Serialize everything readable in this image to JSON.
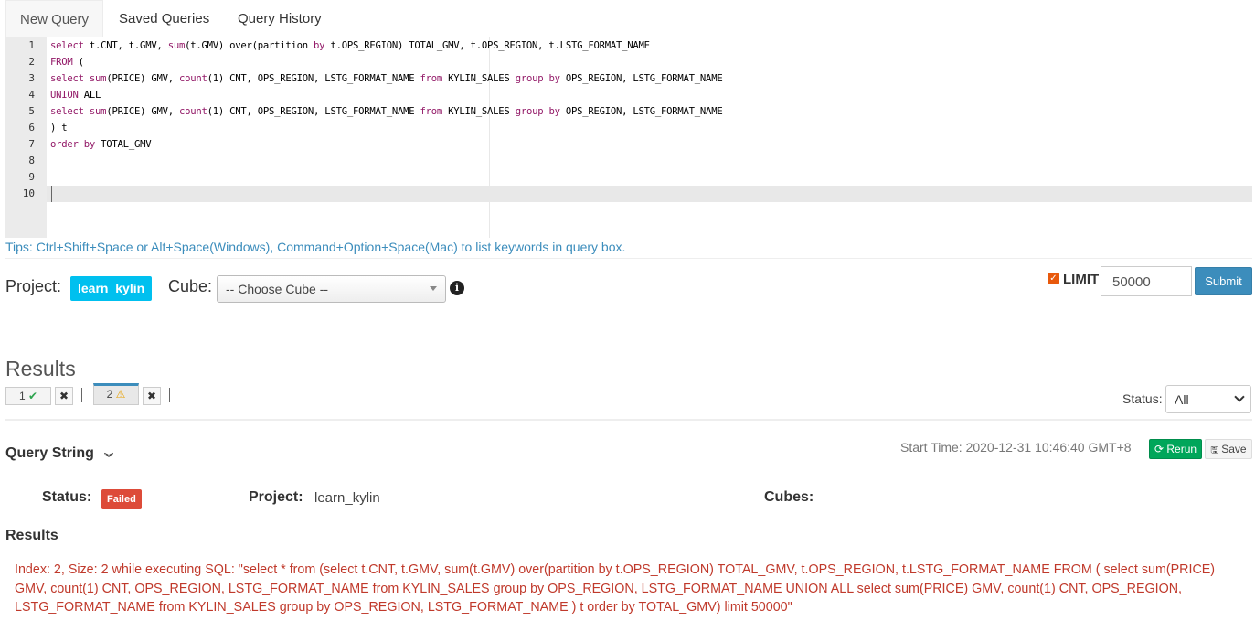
{
  "tabs": [
    {
      "label": "New Query"
    },
    {
      "label": "Saved Queries"
    },
    {
      "label": "Query History"
    }
  ],
  "editor": {
    "line_numbers": [
      "1",
      "2",
      "3",
      "4",
      "5",
      "6",
      "7",
      "8",
      "9",
      "10"
    ],
    "lines": [
      [
        {
          "t": "select",
          "k": true
        },
        {
          "t": " t.CNT, t.GMV, "
        },
        {
          "t": "sum",
          "k": true
        },
        {
          "t": "(t.GMV) over(partition "
        },
        {
          "t": "by",
          "k": true
        },
        {
          "t": " t.OPS_REGION) TOTAL_GMV, t.OPS_REGION, t.LSTG_FORMAT_NAME"
        }
      ],
      [
        {
          "t": "FROM",
          "k": true
        },
        {
          "t": " ("
        }
      ],
      [
        {
          "t": "select",
          "k": true
        },
        {
          "t": " "
        },
        {
          "t": "sum",
          "k": true
        },
        {
          "t": "(PRICE) GMV, "
        },
        {
          "t": "count",
          "k": true
        },
        {
          "t": "(1) CNT, OPS_REGION, LSTG_FORMAT_NAME "
        },
        {
          "t": "from",
          "k": true
        },
        {
          "t": " KYLIN_SALES "
        },
        {
          "t": "group",
          "k": true
        },
        {
          "t": " "
        },
        {
          "t": "by",
          "k": true
        },
        {
          "t": " OPS_REGION, LSTG_FORMAT_NAME"
        }
      ],
      [
        {
          "t": "UNION",
          "k": true
        },
        {
          "t": " ALL"
        }
      ],
      [
        {
          "t": "select",
          "k": true
        },
        {
          "t": " "
        },
        {
          "t": "sum",
          "k": true
        },
        {
          "t": "(PRICE) GMV, "
        },
        {
          "t": "count",
          "k": true
        },
        {
          "t": "(1) CNT, OPS_REGION, LSTG_FORMAT_NAME "
        },
        {
          "t": "from",
          "k": true
        },
        {
          "t": " KYLIN_SALES "
        },
        {
          "t": "group",
          "k": true
        },
        {
          "t": " "
        },
        {
          "t": "by",
          "k": true
        },
        {
          "t": " OPS_REGION, LSTG_FORMAT_NAME"
        }
      ],
      [
        {
          "t": ") t"
        }
      ],
      [
        {
          "t": "order",
          "k": true
        },
        {
          "t": " "
        },
        {
          "t": "by",
          "k": true
        },
        {
          "t": " TOTAL_GMV"
        }
      ],
      [],
      [],
      []
    ]
  },
  "tips": "Tips: Ctrl+Shift+Space or Alt+Space(Windows), Command+Option+Space(Mac) to list keywords in query box.",
  "query_form": {
    "project_label": "Project:",
    "project_value": "learn_kylin",
    "cube_label": "Cube:",
    "cube_selected": "-- Choose Cube --",
    "limit_checked": true,
    "limit_label": "LIMIT",
    "limit_value": "50000",
    "submit_label": "Submit"
  },
  "results": {
    "title": "Results",
    "tabs": [
      {
        "label": "1",
        "status": "ok"
      },
      {
        "label": "2",
        "status": "warning"
      }
    ],
    "status_label": "Status:",
    "status_selected": "All",
    "query_string_label": "Query String",
    "start_time": "Start Time: 2020-12-31 10:46:40 GMT+8",
    "rerun_label": "Rerun",
    "save_label": "Save",
    "status_field_label": "Status:",
    "status_value": "Failed",
    "project_field_label": "Project:",
    "project_field_value": "learn_kylin",
    "cubes_field_label": "Cubes:",
    "results_label": "Results",
    "error_message": "Index: 2, Size: 2 while executing SQL: \"select * from (select t.CNT, t.GMV, sum(t.GMV) over(partition by t.OPS_REGION) TOTAL_GMV, t.OPS_REGION, t.LSTG_FORMAT_NAME FROM ( select sum(PRICE) GMV, count(1) CNT, OPS_REGION, LSTG_FORMAT_NAME from KYLIN_SALES group by OPS_REGION, LSTG_FORMAT_NAME UNION ALL select sum(PRICE) GMV, count(1) CNT, OPS_REGION, LSTG_FORMAT_NAME from KYLIN_SALES group by OPS_REGION, LSTG_FORMAT_NAME ) t order by TOTAL_GMV) limit 50000\""
  },
  "colors": {
    "accent": "#3c8dbc",
    "project_badge": "#00c0ef",
    "failed": "#dd4b39",
    "rerun": "#00a65a",
    "sql_keyword": "#931a68"
  }
}
